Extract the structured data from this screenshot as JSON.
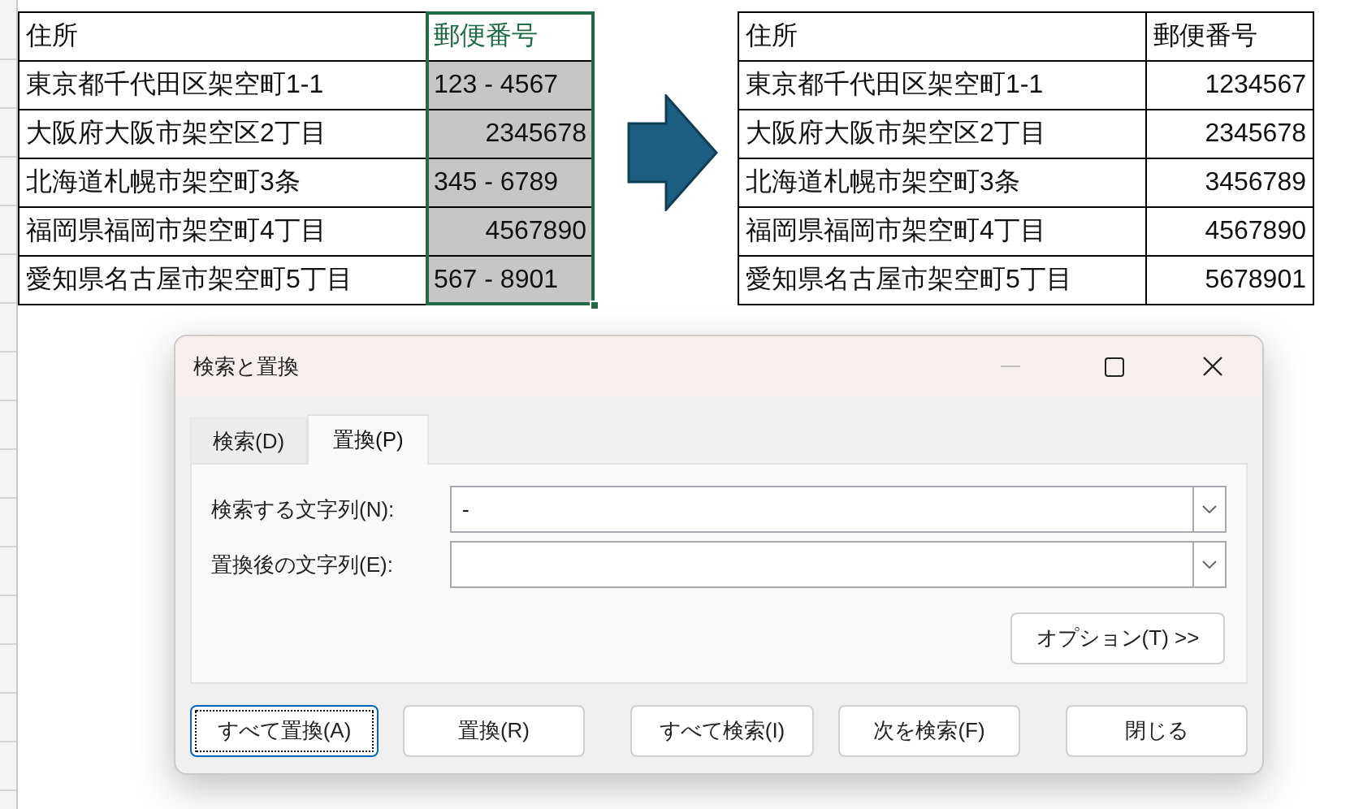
{
  "before_table": {
    "columns": [
      {
        "label": "住所",
        "selected": false
      },
      {
        "label": "郵便番号",
        "selected": true
      }
    ],
    "rows": [
      {
        "address": "東京都千代田区架空町1-1",
        "postal_code": "123 - 4567",
        "kind": "text"
      },
      {
        "address": "大阪府大阪市架空区2丁目",
        "postal_code": "2345678",
        "kind": "number"
      },
      {
        "address": "北海道札幌市架空町3条",
        "postal_code": "345 - 6789",
        "kind": "text"
      },
      {
        "address": "福岡県福岡市架空町4丁目",
        "postal_code": "4567890",
        "kind": "number"
      },
      {
        "address": "愛知県名古屋市架空町5丁目",
        "postal_code": "567 - 8901",
        "kind": "text"
      }
    ]
  },
  "after_table": {
    "columns": [
      {
        "label": "住所",
        "selected": false
      },
      {
        "label": "郵便番号",
        "selected": false
      }
    ],
    "rows": [
      {
        "address": "東京都千代田区架空町1-1",
        "postal_code": "1234567",
        "kind": "number"
      },
      {
        "address": "大阪府大阪市架空区2丁目",
        "postal_code": "2345678",
        "kind": "number"
      },
      {
        "address": "北海道札幌市架空町3条",
        "postal_code": "3456789",
        "kind": "number"
      },
      {
        "address": "福岡県福岡市架空町4丁目",
        "postal_code": "4567890",
        "kind": "number"
      },
      {
        "address": "愛知県名古屋市架空町5丁目",
        "postal_code": "5678901",
        "kind": "number"
      }
    ]
  },
  "dialog": {
    "title": "検索と置換",
    "tabs": [
      {
        "label": "検索(D)",
        "selected": false
      },
      {
        "label": "置換(P)",
        "selected": true
      }
    ],
    "fields": [
      {
        "label": "検索する文字列(N):",
        "value": "-"
      },
      {
        "label": "置換後の文字列(E):"
      }
    ],
    "options_button": "オプション(T) >>",
    "buttons": [
      {
        "label": "すべて置換(A)",
        "focused": true
      },
      {
        "label": "置換(R)",
        "focused": false
      },
      {
        "label": "すべて検索(I)",
        "focused": false
      },
      {
        "label": "次を検索(F)",
        "focused": false
      },
      {
        "label": "閉じる",
        "focused": false
      }
    ]
  }
}
